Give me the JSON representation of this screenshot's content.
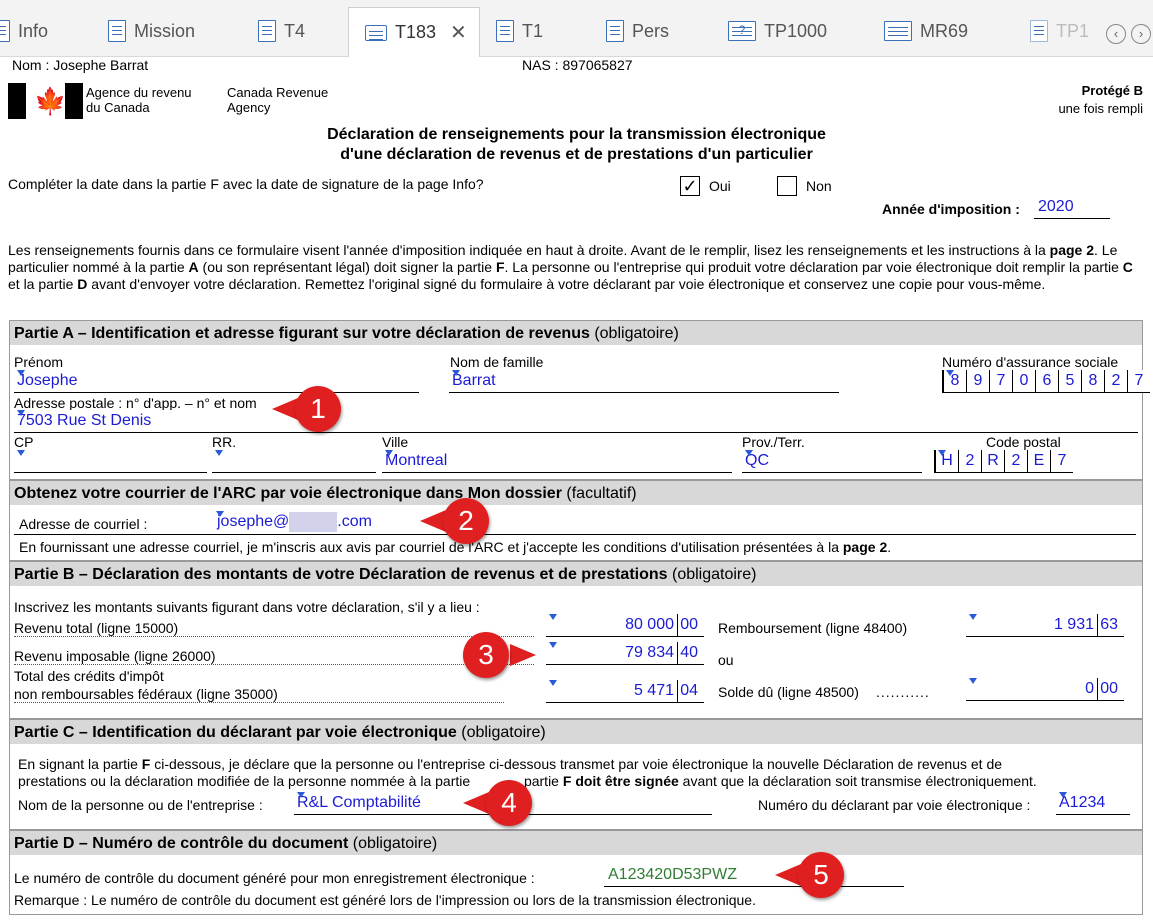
{
  "tabs": [
    {
      "label": "Info",
      "active": false
    },
    {
      "label": "Mission",
      "active": false
    },
    {
      "label": "T4",
      "active": false
    },
    {
      "label": "T183",
      "active": true
    },
    {
      "label": "T1",
      "active": false
    },
    {
      "label": "Pers",
      "active": false
    },
    {
      "label": "TP1000",
      "active": false
    },
    {
      "label": "MR69",
      "active": false
    },
    {
      "label": "TP1",
      "active": false
    }
  ],
  "header": {
    "name": "Nom : Josephe Barrat",
    "nas": "NAS : 897065827",
    "agency_fr_1": "Agence du revenu",
    "agency_fr_2": "du Canada",
    "agency_en_1": "Canada Revenue",
    "agency_en_2": "Agency",
    "protege_1": "Protégé B",
    "protege_2": "une fois rempli",
    "title_1": "Déclaration de renseignements pour la transmission électronique",
    "title_2": "d'une déclaration de revenus et de prestations d'un particulier",
    "question": "Compléter la date dans la partie F avec la date de signature de la page Info?",
    "oui": "Oui",
    "non": "Non",
    "annee_label": "Année d'imposition :",
    "annee_value": "2020"
  },
  "intro": {
    "t1": "Les renseignements fournis dans ce formulaire visent l'année d'imposition indiquée en haut à droite. Avant de le remplir, lisez les renseignements et les instructions à la ",
    "b1": "page 2",
    "t2": ". Le particulier nommé à la partie ",
    "b2": "A",
    "t3": " (ou son représentant légal) doit signer la partie ",
    "b3": "F",
    "t4": ". La personne ou l'entreprise qui produit votre déclaration par voie électronique doit remplir la partie ",
    "b4": "C",
    "t5": " et la partie ",
    "b5": "D",
    "t6": " avant d'envoyer votre déclaration. Remettez l'original signé du formulaire à votre déclarant par voie électronique et conservez une copie pour vous-même."
  },
  "partA": {
    "title": "Partie A – Identification et adresse figurant sur votre déclaration de revenus",
    "opt": "(obligatoire)",
    "prenom_label": "Prénom",
    "prenom": "Josephe",
    "nom_label": "Nom de famille",
    "nom": "Barrat",
    "nas_label": "Numéro d'assurance sociale",
    "nas_digits": [
      "8",
      "9",
      "7",
      "0",
      "6",
      "5",
      "8",
      "2",
      "7"
    ],
    "adresse_label": "Adresse postale : n° d'app. – n° et nom",
    "adresse": "7503 Rue St Denis",
    "cp_label": "CP",
    "rr_label": "RR.",
    "ville_label": "Ville",
    "ville": "Montreal",
    "prov_label": "Prov./Terr.",
    "prov": "QC",
    "code_label": "Code postal",
    "code_digits": [
      "H",
      "2",
      "R",
      "2",
      "E",
      "7"
    ]
  },
  "courriel": {
    "title": "Obtenez votre courrier de l'ARC par voie électronique dans Mon dossier",
    "opt": "(facultatif)",
    "label": "Adresse de courriel :",
    "value_1": "josephe@",
    "value_2": ".com",
    "note_1": "En fournissant une adresse courriel, je m'inscris aux avis par courriel de l'ARC et j'accepte les conditions d'utilisation présentées à la ",
    "note_b": "page 2",
    "note_2": "."
  },
  "partB": {
    "title": "Partie B – Déclaration des montants de votre Déclaration de revenus et de prestations",
    "opt": "(obligatoire)",
    "intro": "Inscrivez les montants suivants figurant dans votre déclaration, s'il y a lieu :",
    "revenu_total_label": "Revenu total (ligne 15000)",
    "revenu_total": "80 000",
    "revenu_total_c": "00",
    "revenu_imp_label": "Revenu imposable (ligne 26000)",
    "revenu_imp": "79 834",
    "revenu_imp_c": "40",
    "credits_label_1": "Total des crédits d'impôt",
    "credits_label_2": "non remboursables fédéraux (ligne 35000)",
    "credits": "5 471",
    "credits_c": "04",
    "remb_label": "Remboursement (ligne 48400)",
    "remb": "1 931",
    "remb_c": "63",
    "ou": "ou",
    "solde_label": "Solde dû (ligne 48500)",
    "solde": "0",
    "solde_c": "00"
  },
  "partC": {
    "title": "Partie C – Identification du déclarant par voie électronique",
    "opt": "(obligatoire)",
    "text_1a": "En signant la partie ",
    "text_1b": "F",
    "text_1c": " ci-dessous, je déclare que la personne ou l'entreprise ci-dessous transmet par voie électronique la nouvelle Déclaration de revenus et de",
    "text_2a": "prestations ou la déclaration modifiée de la personne nommée à la partie ",
    "text_2c": " partie ",
    "text_2d": "F doit être signée",
    "text_2e": " avant que la déclaration soit transmise électroniquement.",
    "nom_label": "Nom de la personne ou de l'entreprise :",
    "nom": "R&L Comptabilité",
    "num_label": "Numéro du déclarant par voie électronique :",
    "num": "A1234"
  },
  "partD": {
    "title": "Partie D – Numéro de contrôle du document",
    "opt": "(obligatoire)",
    "label": "Le numéro de contrôle du document généré pour mon enregistrement électronique :",
    "value": "A123420D53PWZ",
    "remarque": "Remarque : Le numéro de contrôle du document est généré lors de l'impression ou lors de la transmission électronique."
  },
  "callouts": [
    "1",
    "2",
    "3",
    "4",
    "5"
  ],
  "colors": {
    "callout": "#e02020",
    "field_text": "#1b1bd6",
    "control_text": "#2e7d32",
    "section_bg": "#d8d8d8"
  }
}
